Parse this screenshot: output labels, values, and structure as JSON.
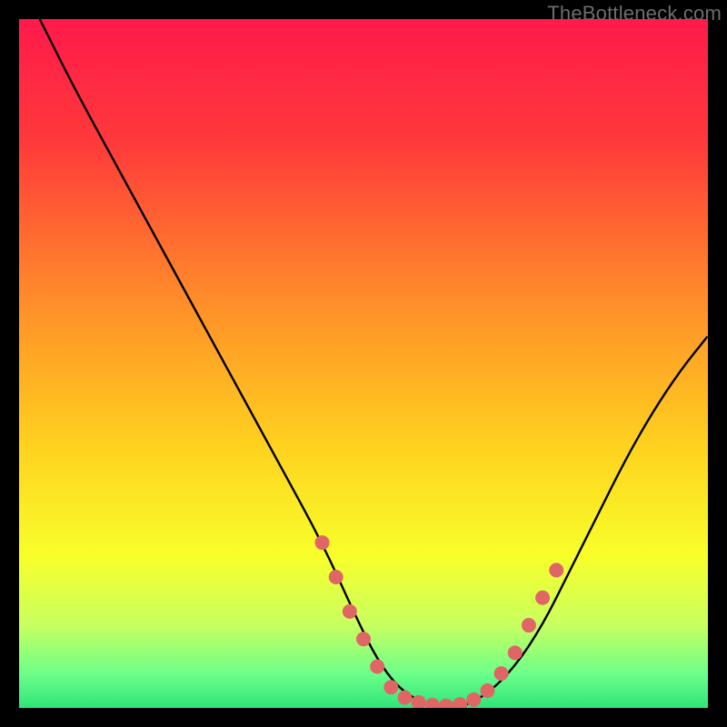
{
  "watermark": "TheBottleneck.com",
  "chart_data": {
    "type": "line",
    "title": "",
    "xlabel": "",
    "ylabel": "",
    "xlim": [
      0,
      100
    ],
    "ylim": [
      0,
      100
    ],
    "background_gradient_stops": [
      {
        "offset": 0,
        "color": "#ff1a4b"
      },
      {
        "offset": 18,
        "color": "#ff3a3a"
      },
      {
        "offset": 40,
        "color": "#ff8a2a"
      },
      {
        "offset": 62,
        "color": "#ffd21f"
      },
      {
        "offset": 78,
        "color": "#f7ff2a"
      },
      {
        "offset": 88,
        "color": "#c8ff60"
      },
      {
        "offset": 95,
        "color": "#6dff8a"
      },
      {
        "offset": 100,
        "color": "#2fe47a"
      }
    ],
    "series": [
      {
        "name": "bottleneck-curve",
        "x": [
          3,
          8,
          14,
          20,
          26,
          32,
          38,
          44,
          49,
          52,
          55,
          58,
          61,
          64,
          68,
          72,
          76,
          80,
          84,
          88,
          92,
          96,
          100
        ],
        "y": [
          100,
          90,
          79,
          68,
          57,
          46,
          35,
          24,
          13,
          7,
          3,
          1,
          0,
          0,
          2,
          6,
          12,
          20,
          28,
          36,
          43,
          49,
          54
        ]
      }
    ],
    "markers": {
      "name": "highlight-dots",
      "color": "#e06666",
      "radius": 8,
      "points": [
        {
          "x": 44,
          "y": 24
        },
        {
          "x": 46,
          "y": 19
        },
        {
          "x": 48,
          "y": 14
        },
        {
          "x": 50,
          "y": 10
        },
        {
          "x": 52,
          "y": 6
        },
        {
          "x": 54,
          "y": 3
        },
        {
          "x": 56,
          "y": 1.5
        },
        {
          "x": 58,
          "y": 0.8
        },
        {
          "x": 60,
          "y": 0.4
        },
        {
          "x": 62,
          "y": 0.3
        },
        {
          "x": 64,
          "y": 0.5
        },
        {
          "x": 66,
          "y": 1.2
        },
        {
          "x": 68,
          "y": 2.5
        },
        {
          "x": 70,
          "y": 5
        },
        {
          "x": 72,
          "y": 8
        },
        {
          "x": 74,
          "y": 12
        },
        {
          "x": 76,
          "y": 16
        },
        {
          "x": 78,
          "y": 20
        }
      ]
    }
  }
}
